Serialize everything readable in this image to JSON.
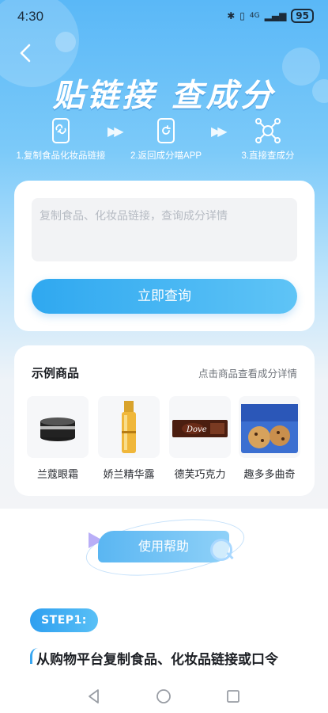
{
  "status": {
    "time": "4:30",
    "network": "4G",
    "battery": "95"
  },
  "header": {
    "title": "贴链接 查成分"
  },
  "steps": [
    {
      "icon": "link-phone-icon",
      "label": "1.复制食品化妆品链接"
    },
    {
      "icon": "return-phone-icon",
      "label": "2.返回成分喵APP"
    },
    {
      "icon": "molecule-icon",
      "label": "3.直接查成分"
    }
  ],
  "query": {
    "placeholder": "复制食品、化妆品链接，查询成分详情",
    "button_label": "立即查询"
  },
  "samples": {
    "title": "示例商品",
    "hint": "点击商品查看成分详情",
    "items": [
      {
        "name": "兰蔻眼霜"
      },
      {
        "name": "娇兰精华露"
      },
      {
        "name": "德芙巧克力"
      },
      {
        "name": "趣多多曲奇"
      }
    ]
  },
  "help": {
    "button_label": "使用帮助"
  },
  "guide": {
    "step_badge": "STEP1:",
    "step_text": "从购物平台复制食品、化妆品链接或口令"
  },
  "colors": {
    "accent": "#3aa7f1",
    "hero_top": "#5ab8f7"
  }
}
